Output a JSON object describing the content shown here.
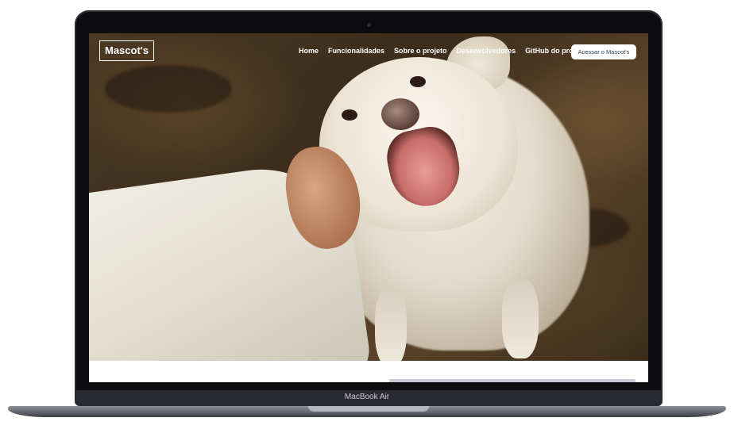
{
  "device": {
    "label": "MacBook Air"
  },
  "site": {
    "logo": "Mascot's",
    "nav": [
      {
        "label": "Home"
      },
      {
        "label": "Funcionalidades"
      },
      {
        "label": "Sobre o projeto"
      },
      {
        "label": "Desenvolvedores"
      },
      {
        "label": "GitHub do projeto"
      }
    ],
    "cta_label": "Acessar o Mascot's"
  },
  "colors": {
    "cta_text": "#1f3a44",
    "laptop_frame": "#0d0d0f",
    "base": "#5f6169"
  }
}
